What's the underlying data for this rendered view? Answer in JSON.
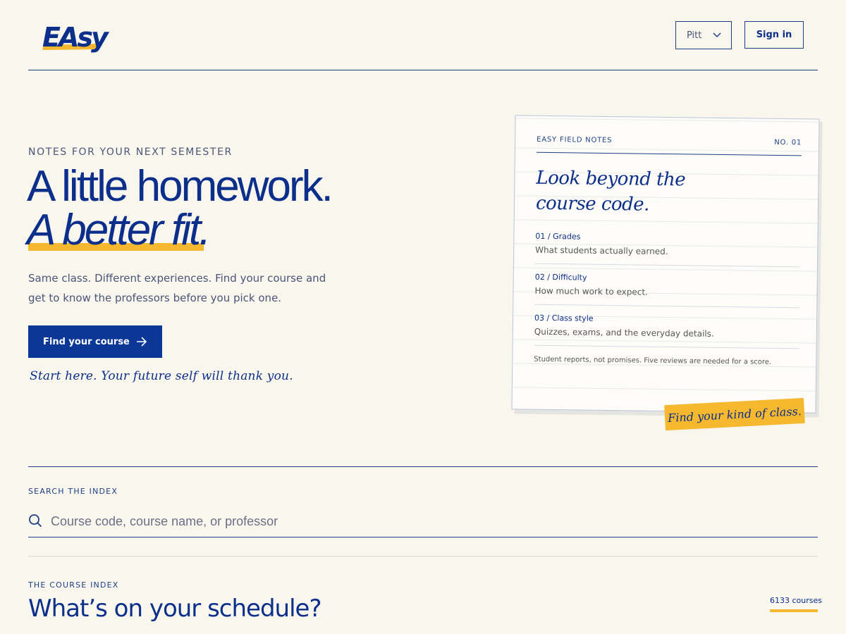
{
  "brand": {
    "logo_text": "EAsy"
  },
  "header": {
    "school_select": {
      "value": "Pitt"
    },
    "signin_label": "Sign in"
  },
  "hero": {
    "eyebrow": "NOTES FOR YOUR NEXT SEMESTER",
    "headline_line1": "A little homework.",
    "headline_line2": "A better fit.",
    "subtext": "Same class. Different experiences. Find your course and get to know the professors before you pick one.",
    "cta_label": "Find your course",
    "handwriting": "Start here. Your future self will thank you."
  },
  "notes_card": {
    "header_left": "EASY FIELD NOTES",
    "header_right": "NO. 01",
    "quote": "Look beyond the course code.",
    "items": [
      {
        "title": "01 / Grades",
        "desc": "What students actually earned."
      },
      {
        "title": "02 / Difficulty",
        "desc": "How much work to expect."
      },
      {
        "title": "03 / Class style",
        "desc": "Quizzes, exams, and the everyday details."
      }
    ],
    "footer": "Student reports, not promises. Five reviews are needed for a score.",
    "sticky_note": "Find your kind of class."
  },
  "search": {
    "label": "SEARCH THE INDEX",
    "placeholder": "Course code, course name, or professor",
    "value": ""
  },
  "course_index": {
    "label": "THE COURSE INDEX",
    "title": "What’s on your schedule?",
    "count": "6133 courses"
  },
  "colors": {
    "background": "#f9f6ee",
    "brand_blue": "#0b2f8a",
    "accent_yellow": "#f5b82e",
    "button_blue": "#0b3797"
  },
  "icons": {
    "school_select": "chevron-down-icon",
    "cta": "arrow-right-icon",
    "search": "search-icon"
  }
}
